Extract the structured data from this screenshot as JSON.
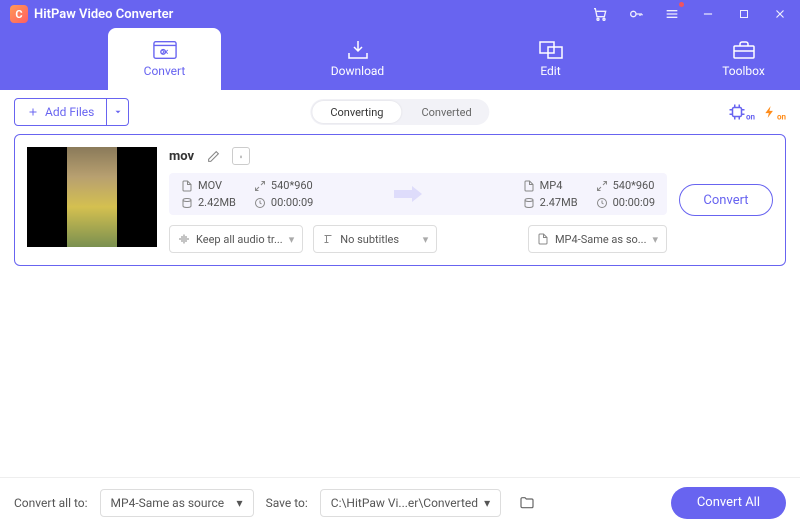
{
  "app": {
    "title": "HitPaw Video Converter"
  },
  "tabs": {
    "convert": "Convert",
    "download": "Download",
    "edit": "Edit",
    "toolbox": "Toolbox"
  },
  "toolbar": {
    "add_files": "Add Files"
  },
  "seg": {
    "converting": "Converting",
    "converted": "Converted"
  },
  "item": {
    "name": "mov",
    "src": {
      "fmt": "MOV",
      "res": "540*960",
      "size": "2.42MB",
      "dur": "00:00:09"
    },
    "dst": {
      "fmt": "MP4",
      "res": "540*960",
      "size": "2.47MB",
      "dur": "00:00:09"
    },
    "audio": "Keep all audio tr...",
    "subtitle": "No subtitles",
    "format": "MP4-Same as so...",
    "convert_btn": "Convert"
  },
  "footer": {
    "convert_all_to_label": "Convert all to:",
    "convert_all_to": "MP4-Same as source",
    "save_to_label": "Save to:",
    "save_to": "C:\\HitPaw Vi...er\\Converted",
    "convert_all_btn": "Convert All"
  },
  "hw": {
    "b1": "on",
    "b2": "on"
  }
}
